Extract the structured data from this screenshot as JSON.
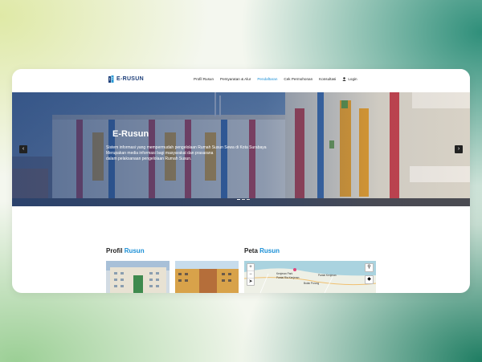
{
  "nav": {
    "logo_text": "E-RUSUN",
    "items": [
      {
        "label": "Profil Rusun",
        "active": false
      },
      {
        "label": "Persyaratan & Alur",
        "active": false
      },
      {
        "label": "Pendaftaran",
        "active": true
      },
      {
        "label": "Cek Permohonan",
        "active": false
      },
      {
        "label": "Konsultasi",
        "active": false
      }
    ],
    "login_label": "Login"
  },
  "hero": {
    "title": "E-Rusun",
    "description_lines": [
      "Sistem informasi yang mempermudah pengelolaan Rumah Susun Sewa di Kota Surabaya",
      "Merupakan media informasi bagi masyarakat dan prasarana",
      "dalam pelaksanaan pengelolaan Rumah Susun."
    ],
    "prev_icon": "chevron-left-icon",
    "next_icon": "chevron-right-icon"
  },
  "profil": {
    "title": "Profil",
    "highlight": "Rusun"
  },
  "peta": {
    "title": "Peta",
    "highlight": "Rusun",
    "map_labels": [
      "Kenjeran Park",
      "Pantai Ria Kenjeran",
      "Pantai Kenjeran",
      "Bulak Porong"
    ],
    "zoom_in": "+",
    "zoom_out": "−"
  },
  "colors": {
    "accent": "#1a8fd6",
    "brand": "#1e3f7a",
    "card_bg": "#ffffff"
  }
}
